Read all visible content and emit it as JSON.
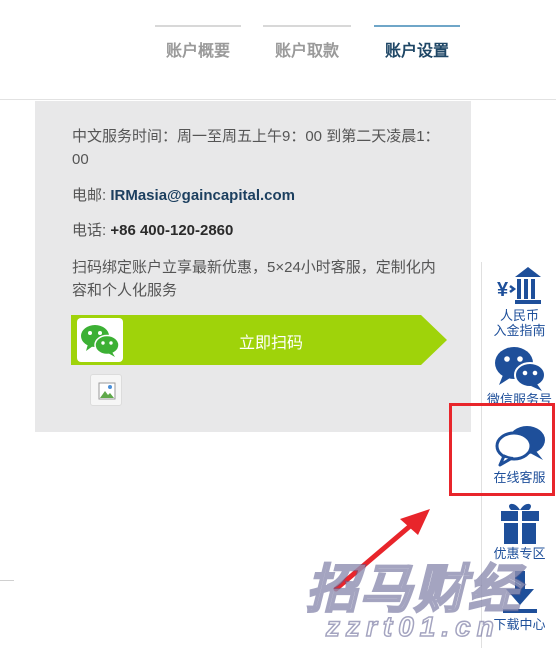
{
  "tabs": [
    {
      "label": "账户概要",
      "active": false
    },
    {
      "label": "账户取款",
      "active": false
    },
    {
      "label": "账户设置",
      "active": true
    }
  ],
  "info": {
    "hours": "中文服务时间：周一至周五上午9：00 到第二天凌晨1：00",
    "email_label": "电邮: ",
    "email": "IRMasia@gaincapital.com",
    "phone_label": "电话: ",
    "phone": "+86 400-120-2860",
    "promo": "扫码绑定账户立享最新优惠，5×24小时客服，定制化内容和个人化服务",
    "scan_button": "立即扫码"
  },
  "sidebar": {
    "items": [
      {
        "label": "人民币\n入金指南",
        "icon": "rmb-deposit-icon"
      },
      {
        "label": "微信服务号",
        "icon": "wechat-icon"
      },
      {
        "label": "在线客服",
        "icon": "chat-bubbles-icon"
      },
      {
        "label": "优惠专区",
        "icon": "gift-icon"
      },
      {
        "label": "下载中心",
        "icon": "download-icon"
      }
    ]
  },
  "watermark": {
    "title": "招马财经",
    "subtitle": "zzrt01.cn"
  },
  "colors": {
    "accent_green": "#9fd30a",
    "active_tab_border": "#6fa6c8",
    "sidebar_blue": "#1e4f9a",
    "highlight_red": "#e8252b",
    "card_bg": "#e8e8e9"
  }
}
